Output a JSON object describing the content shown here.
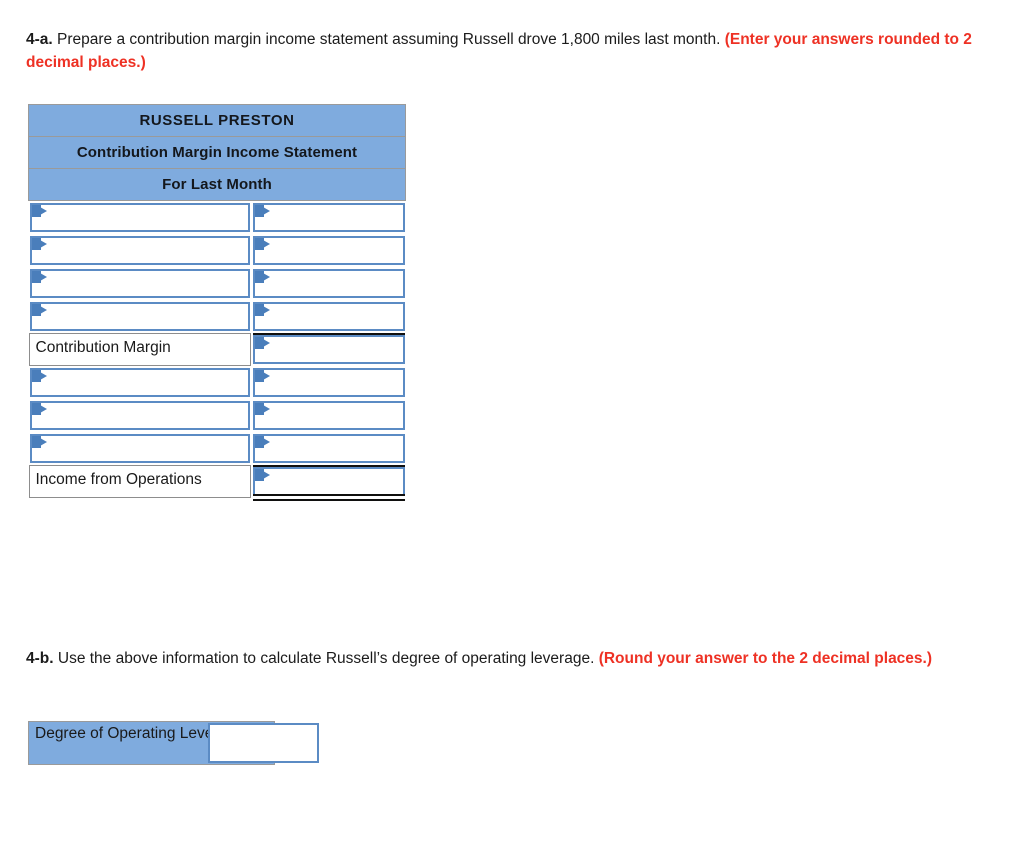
{
  "prompts": {
    "p4a": {
      "number": "4-a.",
      "body": " Prepare a contribution margin income statement assuming Russell drove 1,800 miles last month. ",
      "note": "(Enter your answers rounded to 2 decimal places.)"
    },
    "p4b": {
      "number": "4-b.",
      "body": " Use the above information to calculate Russell’s degree of operating leverage. ",
      "note": "(Round your answer to the 2 decimal places.)"
    }
  },
  "statement": {
    "header": {
      "company": "RUSSELL PRESTON",
      "title": "Contribution Margin Income Statement",
      "period": "For Last Month"
    },
    "rows": [
      {
        "label_type": "select",
        "label": "",
        "label_placeholder": "",
        "amount_value": "",
        "amount_placeholder": "",
        "rule": "none"
      },
      {
        "label_type": "select",
        "label": "",
        "label_placeholder": "",
        "amount_value": "",
        "amount_placeholder": "",
        "rule": "none"
      },
      {
        "label_type": "select",
        "label": "",
        "label_placeholder": "",
        "amount_value": "",
        "amount_placeholder": "",
        "rule": "none"
      },
      {
        "label_type": "select",
        "label": "",
        "label_placeholder": "",
        "amount_value": "",
        "amount_placeholder": "",
        "rule": "none"
      },
      {
        "label_type": "static",
        "label": "Contribution Margin",
        "label_placeholder": "",
        "amount_value": "",
        "amount_placeholder": "",
        "rule": "subtotal-top"
      },
      {
        "label_type": "select",
        "label": "",
        "label_placeholder": "",
        "amount_value": "",
        "amount_placeholder": "",
        "rule": "none"
      },
      {
        "label_type": "select",
        "label": "",
        "label_placeholder": "",
        "amount_value": "",
        "amount_placeholder": "",
        "rule": "none"
      },
      {
        "label_type": "select",
        "label": "",
        "label_placeholder": "",
        "amount_value": "",
        "amount_placeholder": "",
        "rule": "none"
      },
      {
        "label_type": "static",
        "label": "Income from Operations",
        "label_placeholder": "",
        "amount_value": "",
        "amount_placeholder": "",
        "rule": "total-bottom-double"
      }
    ]
  },
  "dol": {
    "label": "Degree of Operating Leverage",
    "value": "",
    "placeholder": ""
  },
  "colors": {
    "header_blue": "#7fabde",
    "control_border_blue": "#5b8bc4",
    "flag_blue": "#4a7ebb",
    "note_red": "#ee3124",
    "rule_black": "#10100f",
    "cell_border_gray": "#9a9a9a"
  }
}
